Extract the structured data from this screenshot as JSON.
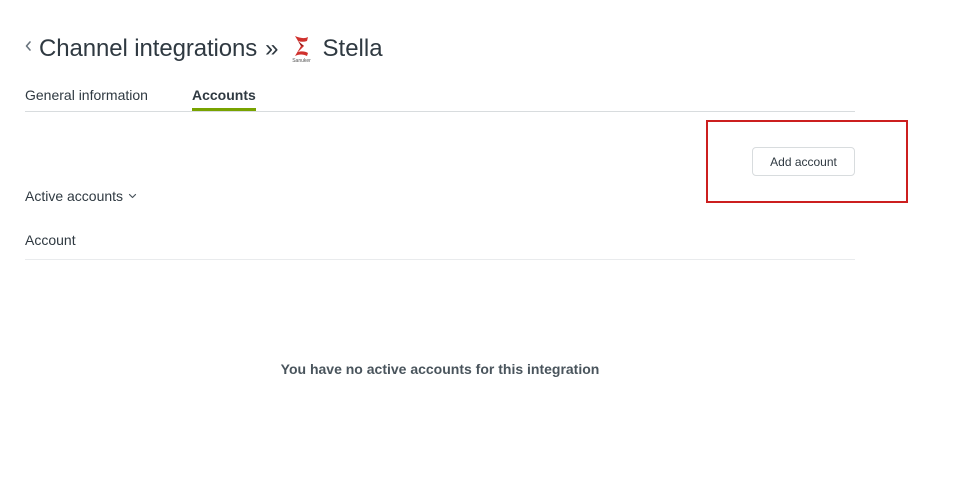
{
  "header": {
    "title": "Channel integrations",
    "separator": "»",
    "integration_name": "Stella",
    "logo_caption": "Sanuker",
    "back_icon": "chevron-left-icon",
    "logo_icon": "sanuker-logo-icon"
  },
  "tabs": [
    {
      "label": "General information",
      "active": false
    },
    {
      "label": "Accounts",
      "active": true
    }
  ],
  "toolbar": {
    "add_account_label": "Add account"
  },
  "filter": {
    "selected": "Active accounts",
    "icon": "chevron-down-icon"
  },
  "table": {
    "columns": [
      "Account"
    ],
    "rows": []
  },
  "empty_state": {
    "message": "You have no active accounts for this integration"
  },
  "colors": {
    "accent": "#78a300",
    "highlight": "#cc1f1f",
    "text": "#2f3941",
    "border": "#d8dcde",
    "logo_red": "#d0312d"
  }
}
